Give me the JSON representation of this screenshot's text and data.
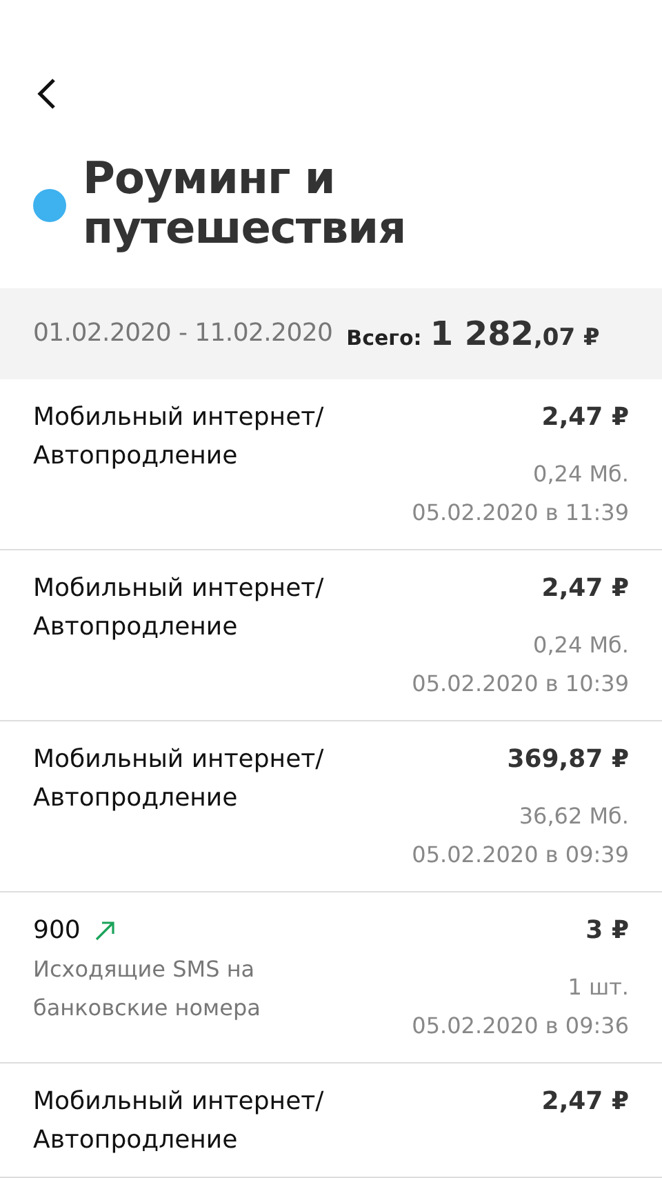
{
  "title": "Роуминг и путешествия",
  "summary": {
    "period": "01.02.2020 - 11.02.2020",
    "total_label": "Всего:",
    "total_integer": "1 282",
    "total_fraction": ",07 ₽"
  },
  "transactions": [
    {
      "title": "Мобильный интернет/ Автопродление",
      "outgoing": false,
      "amount": "2,47 ₽",
      "quantity": "0,24 Мб.",
      "datetime": "05.02.2020 в 11:39"
    },
    {
      "title": "Мобильный интернет/ Автопродление",
      "outgoing": false,
      "amount": "2,47 ₽",
      "quantity": "0,24 Мб.",
      "datetime": "05.02.2020 в 10:39"
    },
    {
      "title": "Мобильный интернет/ Автопродление",
      "outgoing": false,
      "amount": "369,87 ₽",
      "quantity": "36,62 Мб.",
      "datetime": "05.02.2020 в 09:39"
    },
    {
      "title": "900",
      "outgoing": true,
      "subtitle": "Исходящие SMS на банковские номера",
      "amount": "3 ₽",
      "quantity": "1 шт.",
      "datetime": "05.02.2020 в 09:36"
    },
    {
      "title": "Мобильный интернет/ Автопродление",
      "outgoing": false,
      "amount": "2,47 ₽"
    }
  ]
}
